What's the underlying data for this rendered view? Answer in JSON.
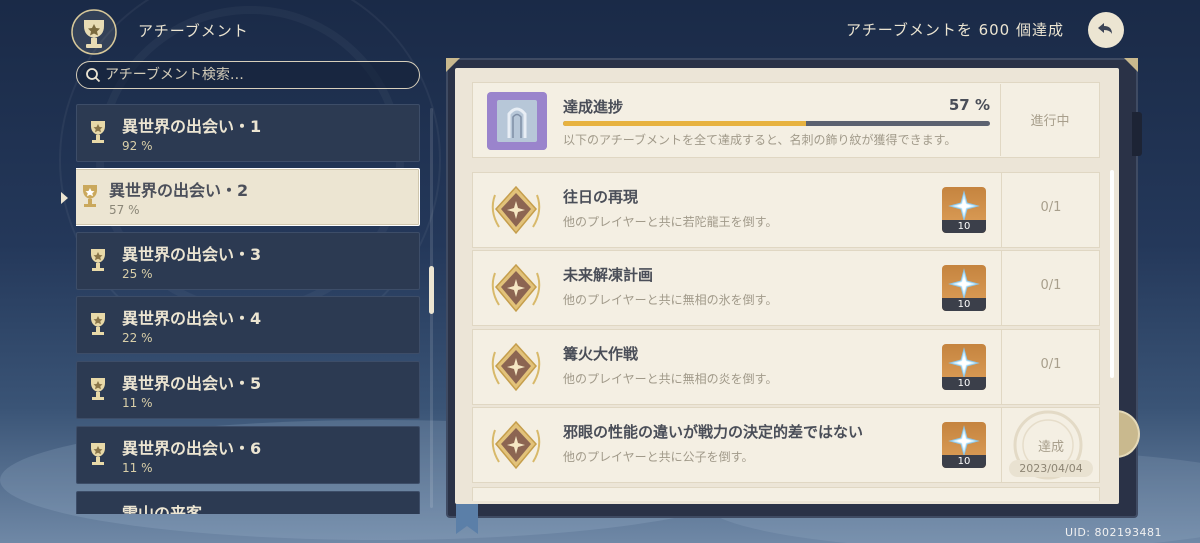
{
  "header": {
    "title": "アチーブメント",
    "summary": "アチーブメントを 600 個達成"
  },
  "search": {
    "placeholder": "アチーブメント検索…"
  },
  "categories": [
    {
      "name": "異世界の出会い・1",
      "percent": "92 %",
      "selected": false
    },
    {
      "name": "異世界の出会い・2",
      "percent": "57 %",
      "selected": true
    },
    {
      "name": "異世界の出会い・3",
      "percent": "25 %",
      "selected": false
    },
    {
      "name": "異世界の出会い・4",
      "percent": "22 %",
      "selected": false
    },
    {
      "name": "異世界の出会い・5",
      "percent": "11 %",
      "selected": false
    },
    {
      "name": "異世界の出会い・6",
      "percent": "11 %",
      "selected": false
    },
    {
      "name": "雪山の来客",
      "percent": "",
      "selected": false
    }
  ],
  "progress": {
    "title": "達成進捗",
    "percent_label": "57 %",
    "value": 0.57,
    "description": "以下のアチーブメントを全て達成すると、名刺の飾り紋が獲得できます。",
    "status": "進行中"
  },
  "achievements": [
    {
      "title": "往日の再現",
      "description": "他のプレイヤーと共に若陀龍王を倒す。",
      "reward_qty": "10",
      "progress": "0/1",
      "completed": false
    },
    {
      "title": "未来解凍計画",
      "description": "他のプレイヤーと共に無相の氷を倒す。",
      "reward_qty": "10",
      "progress": "0/1",
      "completed": false
    },
    {
      "title": "篝火大作戦",
      "description": "他のプレイヤーと共に無相の炎を倒す。",
      "reward_qty": "10",
      "progress": "0/1",
      "completed": false
    },
    {
      "title": "邪眼の性能の違いが戦力の決定的差ではない",
      "description": "他のプレイヤーと共に公子を倒す。",
      "reward_qty": "10",
      "status": "達成",
      "date": "2023/04/04",
      "completed": true
    }
  ],
  "uid": "UID: 802193481",
  "colors": {
    "accent": "#e7b23f",
    "panel_cream": "#ece5d7",
    "sidebar_item": "#2c3a52",
    "reward_orange": "#c5843f"
  },
  "icons": {
    "header": "trophy-emblem-icon",
    "back": "back-arrow-icon",
    "search": "search-icon",
    "category": "trophy-icon",
    "achievement": "achievement-emblem-icon",
    "reward": "primogem-icon"
  }
}
